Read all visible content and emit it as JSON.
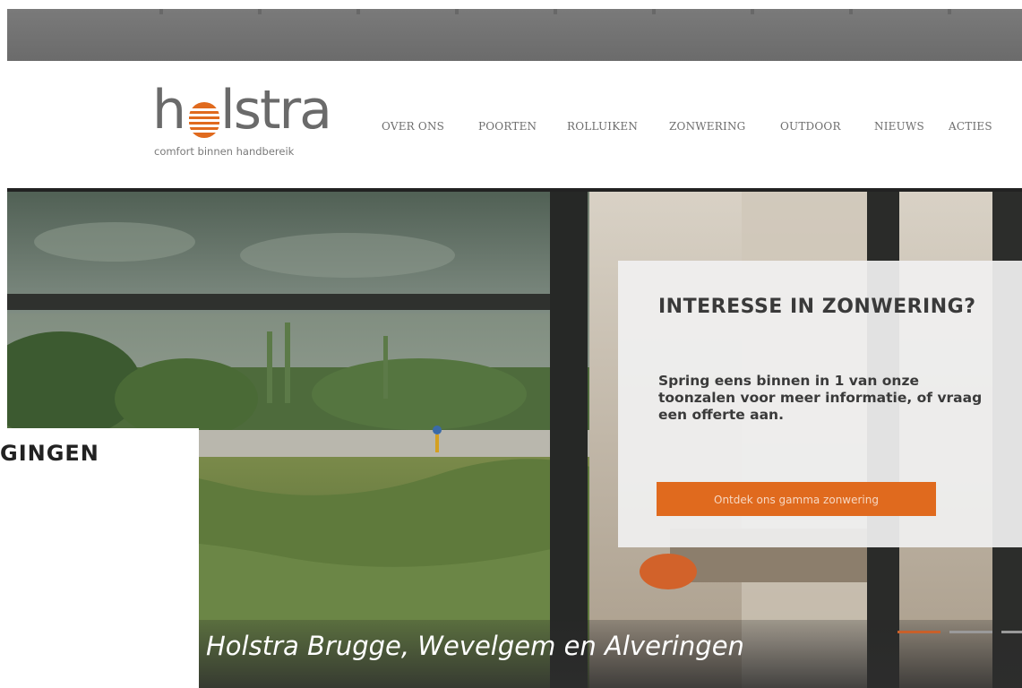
{
  "brand": {
    "name": "holstra",
    "tagline": "comfort binnen handbereik",
    "logo_color": "#6a6a6a",
    "accent": "#e06a1e"
  },
  "nav": {
    "items": [
      {
        "label": "OVER ONS"
      },
      {
        "label": "POORTEN"
      },
      {
        "label": "ROLLUIKEN"
      },
      {
        "label": "ZONWERING"
      },
      {
        "label": "OUTDOOR"
      },
      {
        "label": "NIEUWS"
      },
      {
        "label": "ACTIES"
      }
    ]
  },
  "hero": {
    "cta": {
      "title": "INTERESSE IN ZONWERING?",
      "text": "Spring eens binnen in 1 van onze toonzalen voor meer informatie, of vraag een offerte aan.",
      "button_label": "Ontdek ons gamma zonwering"
    },
    "caption": "Holstra Brugge, Wevelgem en Alveringen",
    "slider_dots": [
      {
        "active": true
      },
      {
        "active": false
      },
      {
        "active": false
      }
    ]
  },
  "overlay": {
    "heading": "GINGEN"
  }
}
